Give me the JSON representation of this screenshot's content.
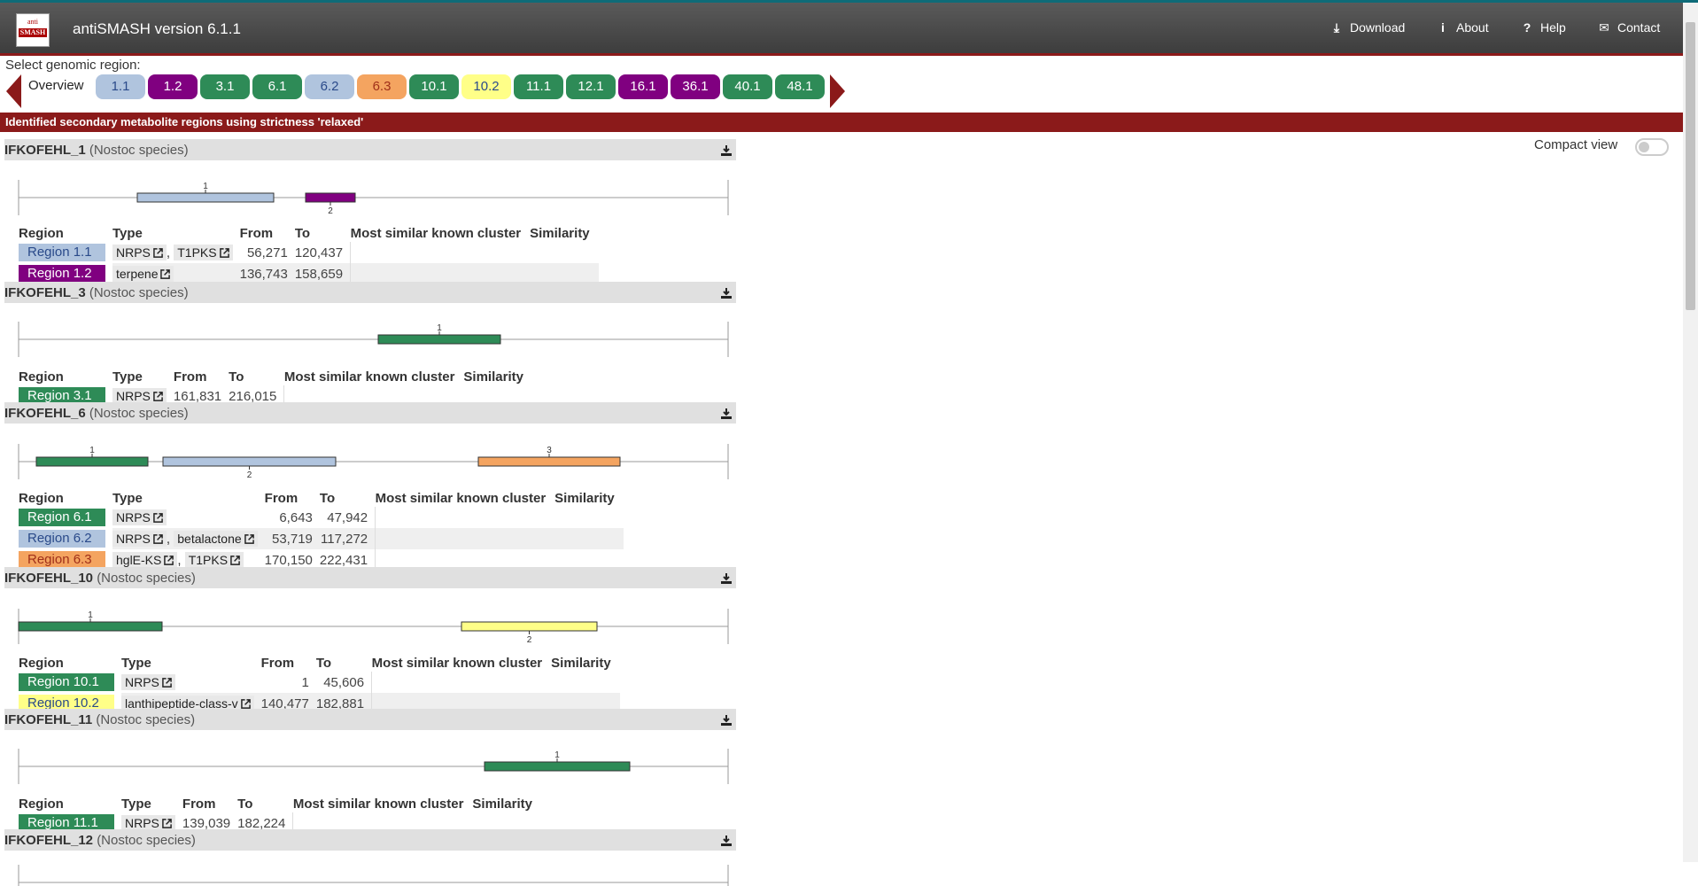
{
  "app": {
    "title": "antiSMASH version 6.1.1",
    "logo_top": "anti",
    "logo_bottom": "SMASH"
  },
  "nav": [
    {
      "label": "Download",
      "icon": "download-icon"
    },
    {
      "label": "About",
      "icon": "info-icon"
    },
    {
      "label": "Help",
      "icon": "help-icon"
    },
    {
      "label": "Contact",
      "icon": "mail-icon"
    }
  ],
  "selector": {
    "label": "Select genomic region:",
    "overview": "Overview",
    "regions": [
      {
        "label": "1.1",
        "bg": "#b0c4de",
        "fg": "#2a4a8a"
      },
      {
        "label": "1.2",
        "bg": "#800080",
        "fg": "#ffffff"
      },
      {
        "label": "3.1",
        "bg": "#2e8b57",
        "fg": "#ffffff"
      },
      {
        "label": "6.1",
        "bg": "#2e8b57",
        "fg": "#ffffff"
      },
      {
        "label": "6.2",
        "bg": "#b0c4de",
        "fg": "#2a4a8a"
      },
      {
        "label": "6.3",
        "bg": "#f4a460",
        "fg": "#a0301a"
      },
      {
        "label": "10.1",
        "bg": "#2e8b57",
        "fg": "#ffffff"
      },
      {
        "label": "10.2",
        "bg": "#ffff88",
        "fg": "#2a4a8a"
      },
      {
        "label": "11.1",
        "bg": "#2e8b57",
        "fg": "#ffffff"
      },
      {
        "label": "12.1",
        "bg": "#2e8b57",
        "fg": "#ffffff"
      },
      {
        "label": "16.1",
        "bg": "#800080",
        "fg": "#ffffff"
      },
      {
        "label": "36.1",
        "bg": "#800080",
        "fg": "#ffffff"
      },
      {
        "label": "40.1",
        "bg": "#2e8b57",
        "fg": "#ffffff"
      },
      {
        "label": "48.1",
        "bg": "#2e8b57",
        "fg": "#ffffff"
      }
    ]
  },
  "banner": "Identified secondary metabolite regions using strictness 'relaxed'",
  "compact_view_label": "Compact view",
  "table_headers": {
    "region": "Region",
    "type": "Type",
    "from": "From",
    "to": "To",
    "similar": "Most similar known cluster",
    "similarity": "Similarity"
  },
  "records": [
    {
      "name": "IFKOFEHL_1",
      "species": "(Nostoc species)",
      "regions": [
        {
          "label": "Region 1.1",
          "bg": "#b0c4de",
          "fg": "#2a4a8a",
          "types": [
            "NRPS",
            "T1PKS"
          ],
          "from": "56,271",
          "to": "120,437",
          "marker": "1"
        },
        {
          "label": "Region 1.2",
          "bg": "#800080",
          "fg": "#ffffff",
          "types": [
            "terpene"
          ],
          "from": "136,743",
          "to": "158,659",
          "marker": "2"
        }
      ]
    },
    {
      "name": "IFKOFEHL_3",
      "species": "(Nostoc species)",
      "regions": [
        {
          "label": "Region 3.1",
          "bg": "#2e8b57",
          "fg": "#ffffff",
          "types": [
            "NRPS"
          ],
          "from": "161,831",
          "to": "216,015",
          "marker": "1"
        }
      ]
    },
    {
      "name": "IFKOFEHL_6",
      "species": "(Nostoc species)",
      "regions": [
        {
          "label": "Region 6.1",
          "bg": "#2e8b57",
          "fg": "#ffffff",
          "types": [
            "NRPS"
          ],
          "from": "6,643",
          "to": "47,942",
          "marker": "1"
        },
        {
          "label": "Region 6.2",
          "bg": "#b0c4de",
          "fg": "#2a4a8a",
          "types": [
            "NRPS",
            "betalactone"
          ],
          "from": "53,719",
          "to": "117,272",
          "marker": "2"
        },
        {
          "label": "Region 6.3",
          "bg": "#f4a460",
          "fg": "#a0301a",
          "types": [
            "hglE-KS",
            "T1PKS"
          ],
          "from": "170,150",
          "to": "222,431",
          "marker": "3"
        }
      ]
    },
    {
      "name": "IFKOFEHL_10",
      "species": "(Nostoc species)",
      "regions": [
        {
          "label": "Region 10.1",
          "bg": "#2e8b57",
          "fg": "#ffffff",
          "types": [
            "NRPS"
          ],
          "from": "1",
          "to": "45,606",
          "marker": "1"
        },
        {
          "label": "Region 10.2",
          "bg": "#ffff88",
          "fg": "#2a4a8a",
          "types": [
            "lanthipeptide-class-v"
          ],
          "from": "140,477",
          "to": "182,881",
          "marker": "2"
        }
      ]
    },
    {
      "name": "IFKOFEHL_11",
      "species": "(Nostoc species)",
      "regions": [
        {
          "label": "Region 11.1",
          "bg": "#2e8b57",
          "fg": "#ffffff",
          "types": [
            "NRPS"
          ],
          "from": "139,039",
          "to": "182,224",
          "marker": "1"
        }
      ]
    },
    {
      "name": "IFKOFEHL_12",
      "species": "(Nostoc species)",
      "regions": []
    }
  ]
}
